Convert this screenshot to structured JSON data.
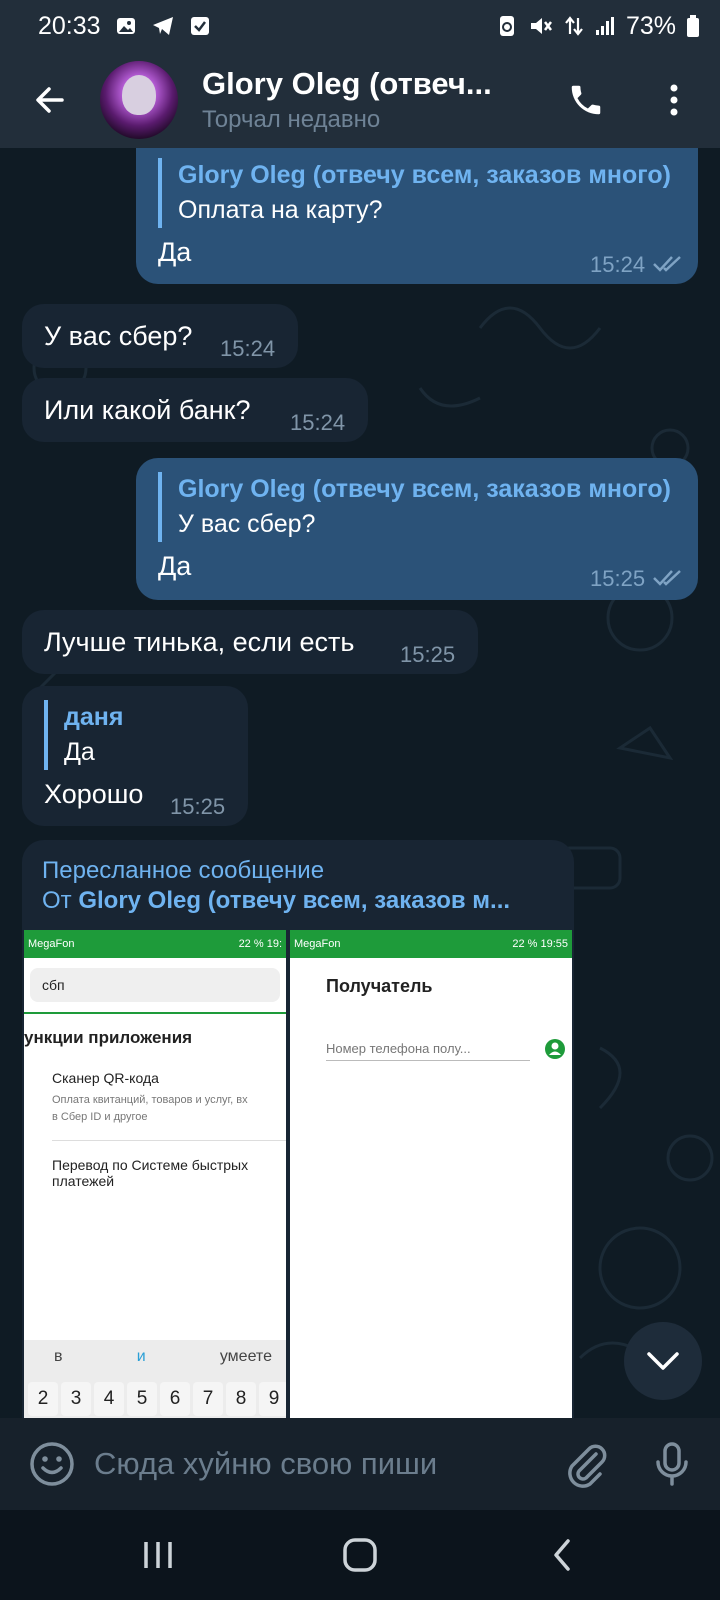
{
  "status_bar": {
    "time": "20:33",
    "left_icons": [
      "gallery-icon",
      "telegram-icon",
      "check-box-icon"
    ],
    "right_icons": [
      "recycle-icon",
      "mute-icon",
      "data-arrows-icon",
      "signal-icon"
    ],
    "battery": "73%"
  },
  "header": {
    "name": "Glory Oleg (отвеч...",
    "status": "Торчал недавно"
  },
  "messages": {
    "m1": {
      "reply_name": "Glory Oleg (отвечу всем, заказов много)",
      "reply_text": "Оплата на карту?",
      "text": "Да",
      "time": "15:24"
    },
    "m2": {
      "text": "У вас сбер?",
      "time": "15:24"
    },
    "m3": {
      "text": "Или какой банк?",
      "time": "15:24"
    },
    "m4": {
      "reply_name": "Glory Oleg (отвечу всем, заказов много)",
      "reply_text": "У вас сбер?",
      "text": "Да",
      "time": "15:25"
    },
    "m5": {
      "text": "Лучше тинька, если есть",
      "time": "15:25"
    },
    "m6": {
      "reply_name": "даня",
      "reply_text": "Да",
      "text": "Хорошо",
      "time": "15:25"
    },
    "m7": {
      "forward_label": "Пересланное сообщение",
      "forward_from_prefix": "От ",
      "forward_from": "Glory Oleg (отвечу всем, заказов м..."
    }
  },
  "shot1": {
    "status_left": "MegaFon",
    "status_right": "22 %",
    "status_time": "19:",
    "search": "сбп",
    "heading": "ункции приложения",
    "item1": "Сканер QR-кода",
    "item1_sub1": "Оплата квитанций, товаров и услуг, вх",
    "item1_sub2": "в Сбер ID и другое",
    "item2_line1": "Перевод по Системе быстрых",
    "item2_line2": "платежей",
    "suggestions": [
      "в",
      "и",
      "умеете"
    ],
    "keys": [
      "2",
      "3",
      "4",
      "5",
      "6",
      "7",
      "8",
      "9"
    ]
  },
  "shot2": {
    "status_left": "MegaFon",
    "status_right": "22 %",
    "status_time": "19:55",
    "title": "Получатель",
    "field_placeholder": "Номер телефона полу..."
  },
  "input": {
    "placeholder": "Сюда хуйню свою пиши"
  },
  "colors": {
    "header_bg": "#222e3a",
    "chat_bg": "#0f1b24",
    "outgoing_bubble": "#2b5278",
    "incoming_bubble": "#182533",
    "accent": "#6fb3f0",
    "sber_green": "#1e9b3a"
  }
}
